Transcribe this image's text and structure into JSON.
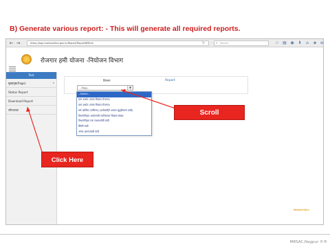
{
  "slide": {
    "title": "B)  Generate various report: - This will generate all required reports.",
    "credit": "MRSAC,Nagpur ©®"
  },
  "browser": {
    "back": "←",
    "forward": "→",
    "url": "https://egs.mahaonline.gov.in/Report/ReportNREvA",
    "search_placeholder": "Search"
  },
  "site": {
    "title": "रोजगार हमी योजना -नियोजन विभाग",
    "footer_logo": "MahaOnline"
  },
  "sidebar": {
    "heading": "Test",
    "items": [
      {
        "label": "मुख्यपृष्ठ(Page)"
      },
      {
        "label": "Status Report"
      },
      {
        "label": "Download Report"
      },
      {
        "label": "लॉगआउट"
      }
    ]
  },
  "report_panel": {
    "select_label": "विभाग",
    "report_label": "Report",
    "select_value": "--निवडा--",
    "options": [
      "--Select--",
      "ग्राम अर्थात (मत्स्य विकास रोजगार)",
      "ग्राम अर्थात (मत्स्य विकास रोजगार)",
      "सर्व आर्थिक (वाणिज्य) (प्रत्येकाहिने आदान सुदृढीकरण यादी)",
      "विभागनिहाय आबंटनाची तपशिलवार विकास संख्या",
      "विभागनिहाय एक लाभार्थ्यांची यादी",
      "स्थिती यादी",
      "अंगण-आंतरजाळी यादी"
    ],
    "selected_index": 0
  },
  "callouts": {
    "scroll": "Scroll",
    "click": "Click Here"
  },
  "colors": {
    "title_red": "#cc1f1f",
    "callout_red": "#e8251f",
    "sidebar_header_blue": "#3c7bc2",
    "dropdown_selected": "#2e68c6"
  }
}
